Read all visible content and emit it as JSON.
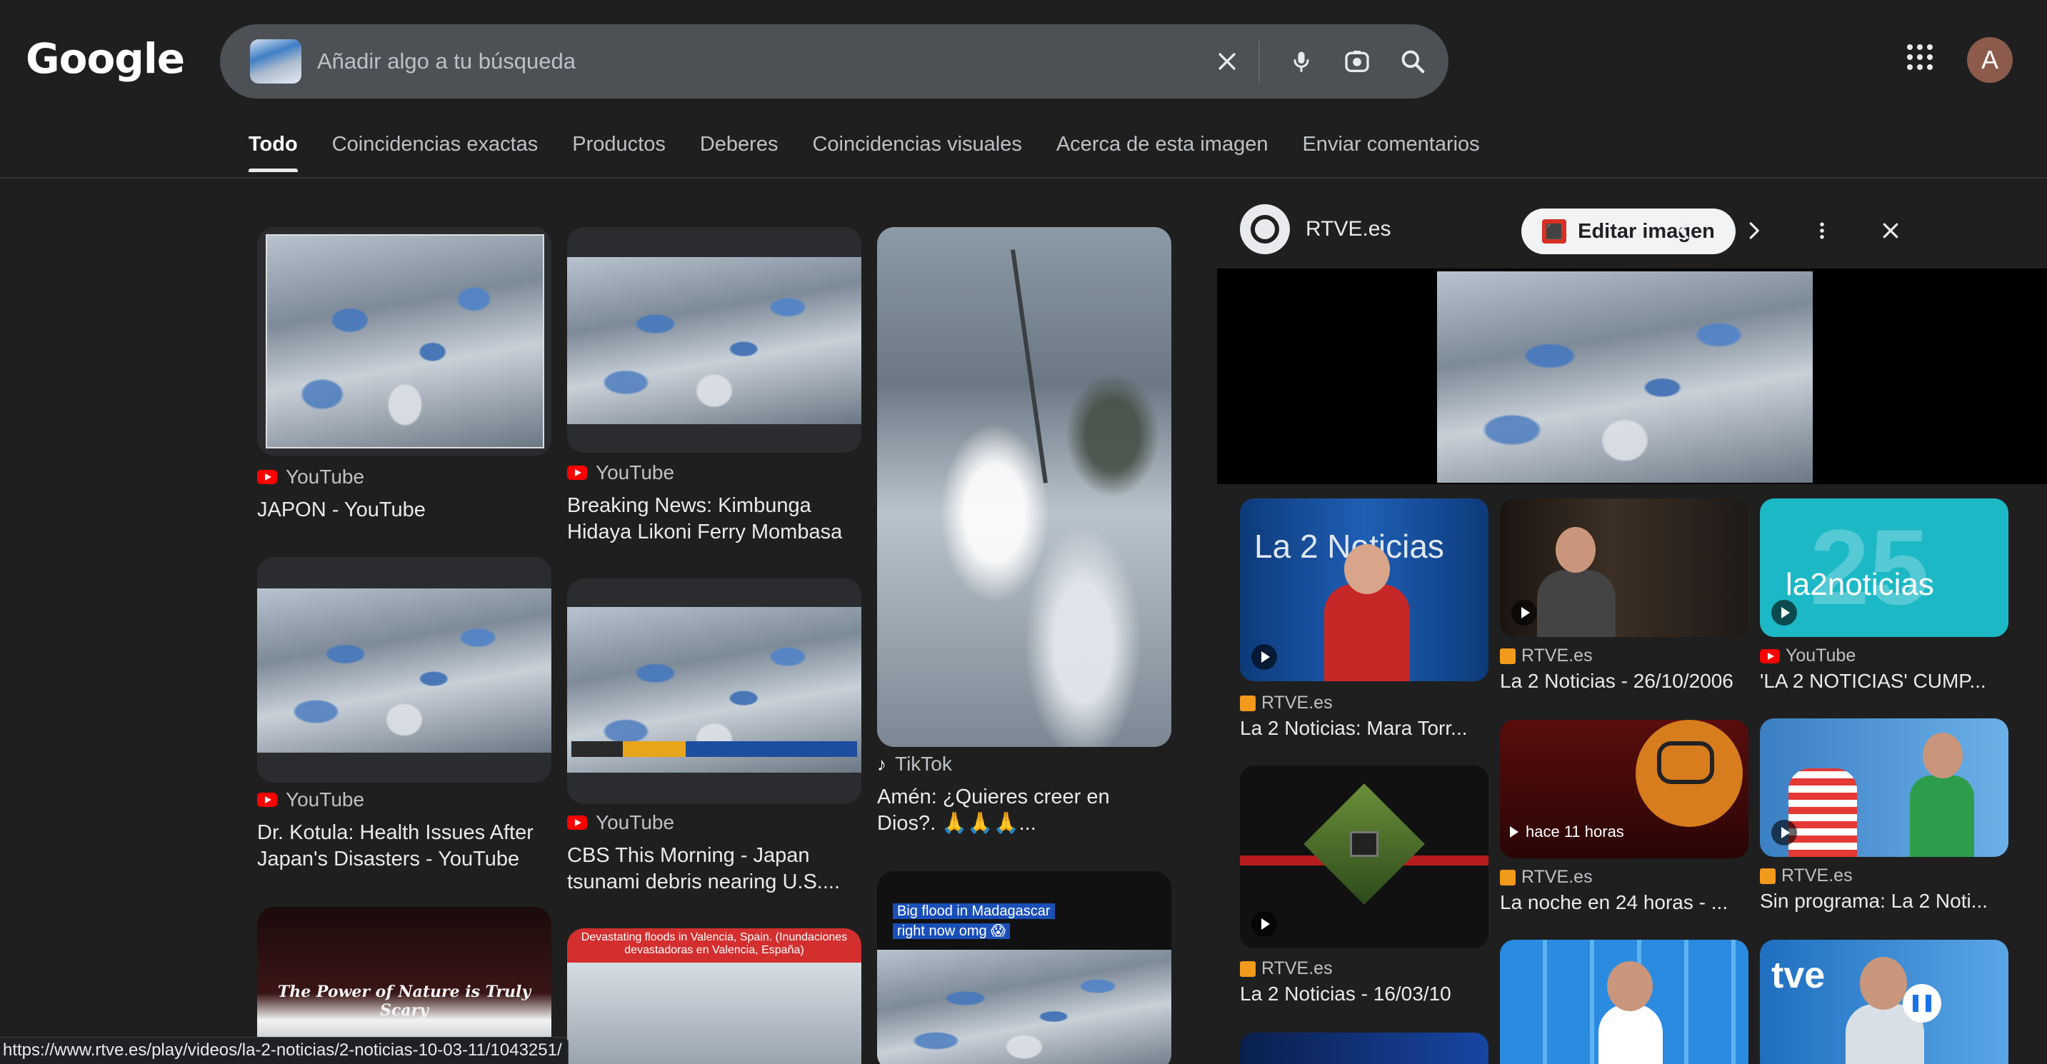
{
  "header": {
    "logo": "Google",
    "search_placeholder": "Añadir algo a tu búsqueda"
  },
  "tabs": [
    {
      "label": "Todo",
      "active": true
    },
    {
      "label": "Coincidencias exactas"
    },
    {
      "label": "Productos"
    },
    {
      "label": "Deberes"
    },
    {
      "label": "Coincidencias visuales"
    },
    {
      "label": "Acerca de esta imagen"
    },
    {
      "label": "Enviar comentarios"
    }
  ],
  "results": [
    {
      "source": "YouTube",
      "title": "JAPON - YouTube"
    },
    {
      "source": "YouTube",
      "title": "Dr. Kotula: Health Issues After Japan's Disasters - YouTube"
    },
    {
      "source": "",
      "title": "",
      "overlay": "The Power of Nature is Truly Scary"
    },
    {
      "source": "YouTube",
      "title": "Breaking News: Kimbunga Hidaya Likoni Ferry Mombasa ..."
    },
    {
      "source": "YouTube",
      "title": "CBS This Morning - Japan tsunami debris nearing U.S...."
    },
    {
      "source": "",
      "title": "",
      "overlay": "Devastating floods in Valencia, Spain. (Inundaciones devastadoras en Valencia, España)"
    },
    {
      "source": "TikTok",
      "title": "Amén: ¿Quieres creer en Dios?. 🙏🙏🙏..."
    },
    {
      "source": "",
      "title": "",
      "overlay": "Big flood in Madagascar right now omg 😱"
    }
  ],
  "panel": {
    "site": "RTVE.es",
    "edit_label": "Editar imagen",
    "related": [
      {
        "source": "RTVE.es",
        "title": "La 2 Noticias: Mara Torr...",
        "overlay": "La 2 Noticias"
      },
      {
        "source": "RTVE.es",
        "title": "La 2 Noticias - 26/10/2006"
      },
      {
        "source": "YouTube",
        "title": "'LA 2 NOTICIAS' CUMP...",
        "overlay": "la2noticias"
      },
      {
        "source": "RTVE.es",
        "title": "La 2 Noticias - 16/03/10"
      },
      {
        "source": "RTVE.es",
        "title": "La noche en 24 horas - ...",
        "badge": "hace 11 horas"
      },
      {
        "source": "RTVE.es",
        "title": "Sin programa: La 2 Noti..."
      }
    ]
  },
  "status_url": "https://www.rtve.es/play/videos/la-2-noticias/2-noticias-10-03-11/1043251/",
  "colors": {
    "background": "#1f1f1f",
    "searchbar": "#4d5156",
    "youtube": "#ff0000",
    "rtve": "#f29a1b"
  }
}
